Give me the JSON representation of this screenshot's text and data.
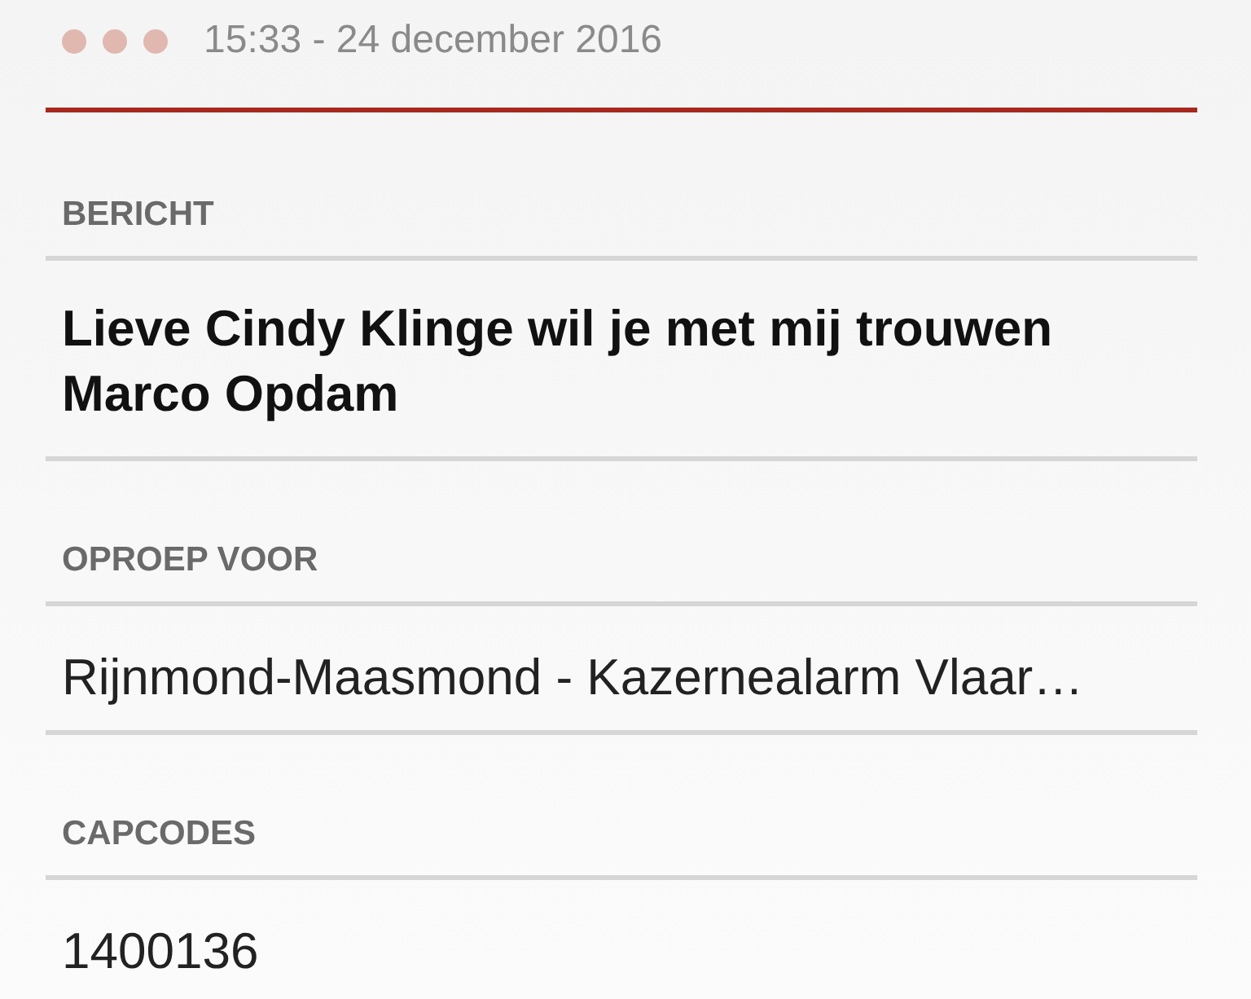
{
  "header": {
    "time": "15:33 - 24 december 2016"
  },
  "sections": [
    {
      "label": "BERICHT",
      "text": "Lieve Cindy Klinge wil je met mij trouwen Marco Opdam",
      "kind": "bold"
    },
    {
      "label": "OPROEP VOOR",
      "text": "Rijnmond-Maasmond - Kazernealarm Vlaar…",
      "kind": "plain"
    },
    {
      "label": "CAPCODES",
      "text": "1400136",
      "kind": "plain"
    }
  ]
}
